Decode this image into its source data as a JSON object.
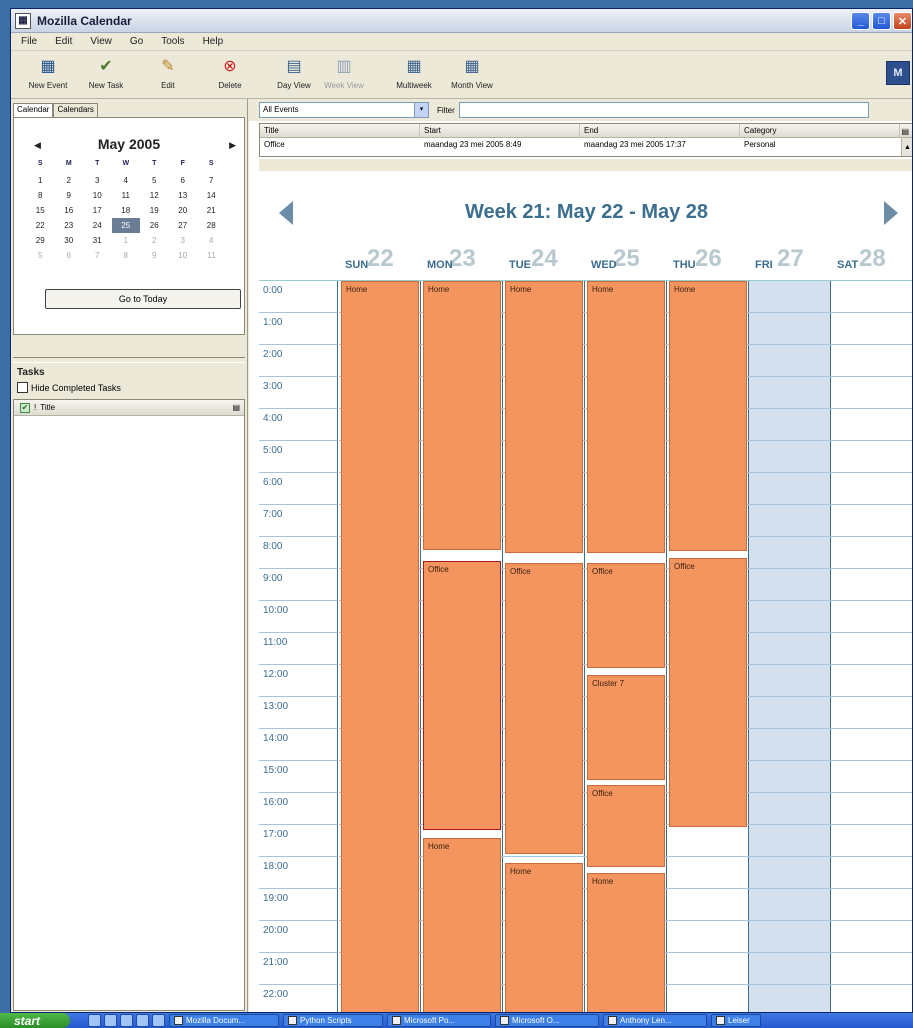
{
  "window": {
    "title": "Mozilla Calendar"
  },
  "menu": [
    "File",
    "Edit",
    "View",
    "Go",
    "Tools",
    "Help"
  ],
  "toolbar": [
    {
      "label": "New Event",
      "icon": "new-event-icon",
      "glyph": "▦",
      "color": "#1f4f8f",
      "enabled": true
    },
    {
      "label": "New Task",
      "icon": "new-task-icon",
      "glyph": "✔",
      "color": "#4b7a2b",
      "enabled": true
    },
    {
      "label": "Edit",
      "icon": "edit-icon",
      "glyph": "✎",
      "color": "#b8801e",
      "enabled": true
    },
    {
      "label": "Delete",
      "icon": "delete-icon",
      "glyph": "⊗",
      "color": "#c81e1e",
      "enabled": true
    },
    {
      "label": "Day View",
      "icon": "day-view-icon",
      "glyph": "▤",
      "color": "#3a5f8f",
      "enabled": true
    },
    {
      "label": "Week View",
      "icon": "week-view-icon",
      "glyph": "▥",
      "color": "#8fa0b8",
      "enabled": false
    },
    {
      "label": "Multiweek",
      "icon": "multiweek-view-icon",
      "glyph": "▦",
      "color": "#3a5f8f",
      "enabled": true
    },
    {
      "label": "Month View",
      "icon": "month-view-icon",
      "glyph": "▦",
      "color": "#3a5f8f",
      "enabled": true
    }
  ],
  "left_tabs": [
    "Calendar",
    "Calendars"
  ],
  "minimonth": {
    "title": "May 2005",
    "prev": "◀",
    "next": "▶",
    "dow": [
      "S",
      "M",
      "T",
      "W",
      "T",
      "F",
      "S"
    ],
    "weeks": [
      [
        {
          "d": "1"
        },
        {
          "d": "2"
        },
        {
          "d": "3"
        },
        {
          "d": "4"
        },
        {
          "d": "5"
        },
        {
          "d": "6"
        },
        {
          "d": "7"
        }
      ],
      [
        {
          "d": "8"
        },
        {
          "d": "9"
        },
        {
          "d": "10"
        },
        {
          "d": "11"
        },
        {
          "d": "12"
        },
        {
          "d": "13"
        },
        {
          "d": "14"
        }
      ],
      [
        {
          "d": "15"
        },
        {
          "d": "16"
        },
        {
          "d": "17"
        },
        {
          "d": "18"
        },
        {
          "d": "19"
        },
        {
          "d": "20"
        },
        {
          "d": "21"
        }
      ],
      [
        {
          "d": "22"
        },
        {
          "d": "23"
        },
        {
          "d": "24"
        },
        {
          "d": "25",
          "selected": true
        },
        {
          "d": "26"
        },
        {
          "d": "27"
        },
        {
          "d": "28"
        }
      ],
      [
        {
          "d": "29"
        },
        {
          "d": "30"
        },
        {
          "d": "31"
        },
        {
          "d": "1",
          "other": true
        },
        {
          "d": "2",
          "other": true
        },
        {
          "d": "3",
          "other": true
        },
        {
          "d": "4",
          "other": true
        }
      ],
      [
        {
          "d": "5",
          "other": true
        },
        {
          "d": "6",
          "other": true
        },
        {
          "d": "7",
          "other": true
        },
        {
          "d": "8",
          "other": true
        },
        {
          "d": "9",
          "other": true
        },
        {
          "d": "10",
          "other": true
        },
        {
          "d": "11",
          "other": true
        }
      ]
    ],
    "today_button": "Go to Today"
  },
  "tasks": {
    "label": "Tasks",
    "hide_completed": "Hide Completed Tasks",
    "column": "Title"
  },
  "filter": {
    "selected": "All Events",
    "dropdown": "▾",
    "label": "Filter"
  },
  "event_list": {
    "columns": [
      "Title",
      "Start",
      "End",
      "Category"
    ],
    "rows": [
      [
        "Office",
        "maandag 23 mei 2005 8:49",
        "maandag 23 mei 2005 17:37",
        "Personal"
      ]
    ]
  },
  "week": {
    "title": "Week 21: May 22 - May 28",
    "days": [
      {
        "name": "SUN",
        "num": "22",
        "off": false
      },
      {
        "name": "MON",
        "num": "23",
        "off": false
      },
      {
        "name": "TUE",
        "num": "24",
        "off": false
      },
      {
        "name": "WED",
        "num": "25",
        "off": false
      },
      {
        "name": "THU",
        "num": "26",
        "off": false
      },
      {
        "name": "FRI",
        "num": "27",
        "off": true
      },
      {
        "name": "SAT",
        "num": "28",
        "off": false
      }
    ],
    "hours": [
      "0:00",
      "1:00",
      "2:00",
      "3:00",
      "4:00",
      "5:00",
      "6:00",
      "7:00",
      "8:00",
      "9:00",
      "10:00",
      "11:00",
      "12:00",
      "13:00",
      "14:00",
      "15:00",
      "16:00",
      "17:00",
      "18:00",
      "19:00",
      "20:00",
      "21:00",
      "22:00"
    ],
    "events": [
      {
        "day": 0,
        "start": 0,
        "end": 23,
        "title": "Home"
      },
      {
        "day": 1,
        "start": 0,
        "end": 8.4,
        "title": "Home"
      },
      {
        "day": 1,
        "start": 8.75,
        "end": 17.15,
        "title": "Office",
        "selected": true
      },
      {
        "day": 1,
        "start": 17.4,
        "end": 23,
        "title": "Home"
      },
      {
        "day": 2,
        "start": 0,
        "end": 8.5,
        "title": "Home"
      },
      {
        "day": 2,
        "start": 8.8,
        "end": 17.9,
        "title": "Office"
      },
      {
        "day": 2,
        "start": 18.2,
        "end": 23,
        "title": "Home"
      },
      {
        "day": 3,
        "start": 0,
        "end": 8.5,
        "title": "Home"
      },
      {
        "day": 3,
        "start": 8.8,
        "end": 12.1,
        "title": "Office"
      },
      {
        "day": 3,
        "start": 12.3,
        "end": 15.6,
        "title": "Cluster 7"
      },
      {
        "day": 3,
        "start": 15.75,
        "end": 18.3,
        "title": "Office"
      },
      {
        "day": 3,
        "start": 18.5,
        "end": 23,
        "title": "Home"
      },
      {
        "day": 4,
        "start": 0,
        "end": 8.45,
        "title": "Home"
      },
      {
        "day": 4,
        "start": 8.65,
        "end": 17.05,
        "title": "Office"
      }
    ]
  },
  "taskbar": {
    "start": "start",
    "windows": [
      "Mozilla Docum...",
      "Python Scripts",
      "Microsoft Po...",
      "Microsoft O...",
      "Anthony Len...",
      "Leiser"
    ]
  }
}
